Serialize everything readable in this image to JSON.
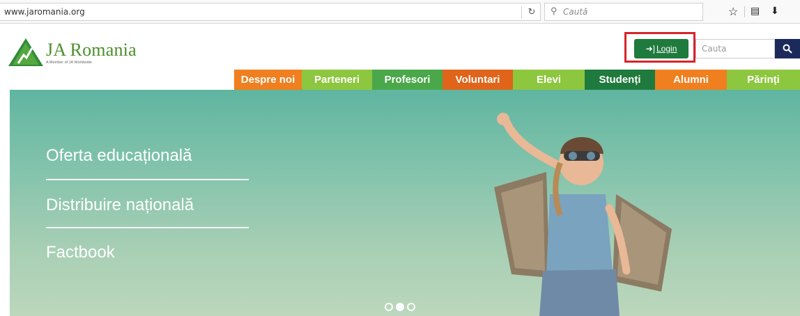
{
  "browser": {
    "url": "www.jaromania.org",
    "search_placeholder": "Caută",
    "icons": [
      "reload-icon",
      "search-icon",
      "bookmark-star-icon",
      "reader-icon",
      "download-icon"
    ]
  },
  "header": {
    "logo_text": "JA Romania",
    "logo_sub": "A Member of JA Worldwide",
    "login_label": "Login",
    "search_placeholder": "Cauta"
  },
  "nav": {
    "items": [
      {
        "label": "Despre noi",
        "color": "#f07f1f"
      },
      {
        "label": "Parteneri",
        "color": "#8dc63f"
      },
      {
        "label": "Profesori",
        "color": "#4aa84a"
      },
      {
        "label": "Voluntari",
        "color": "#e0641a"
      },
      {
        "label": "Elevi",
        "color": "#8dc63f"
      },
      {
        "label": "Studenți",
        "color": "#1f7a3d"
      },
      {
        "label": "Alumni",
        "color": "#f07f1f"
      },
      {
        "label": "Părinți",
        "color": "#8dc63f"
      }
    ]
  },
  "hero": {
    "links": [
      "Oferta educațională",
      "Distribuire națională",
      "Factbook"
    ],
    "active_slide": 2,
    "slide_count": 3
  },
  "colors": {
    "brand_green": "#4a8f2c",
    "login_green": "#1f7a3d",
    "highlight_red": "#d8232a",
    "search_navy": "#1b2a5a"
  }
}
